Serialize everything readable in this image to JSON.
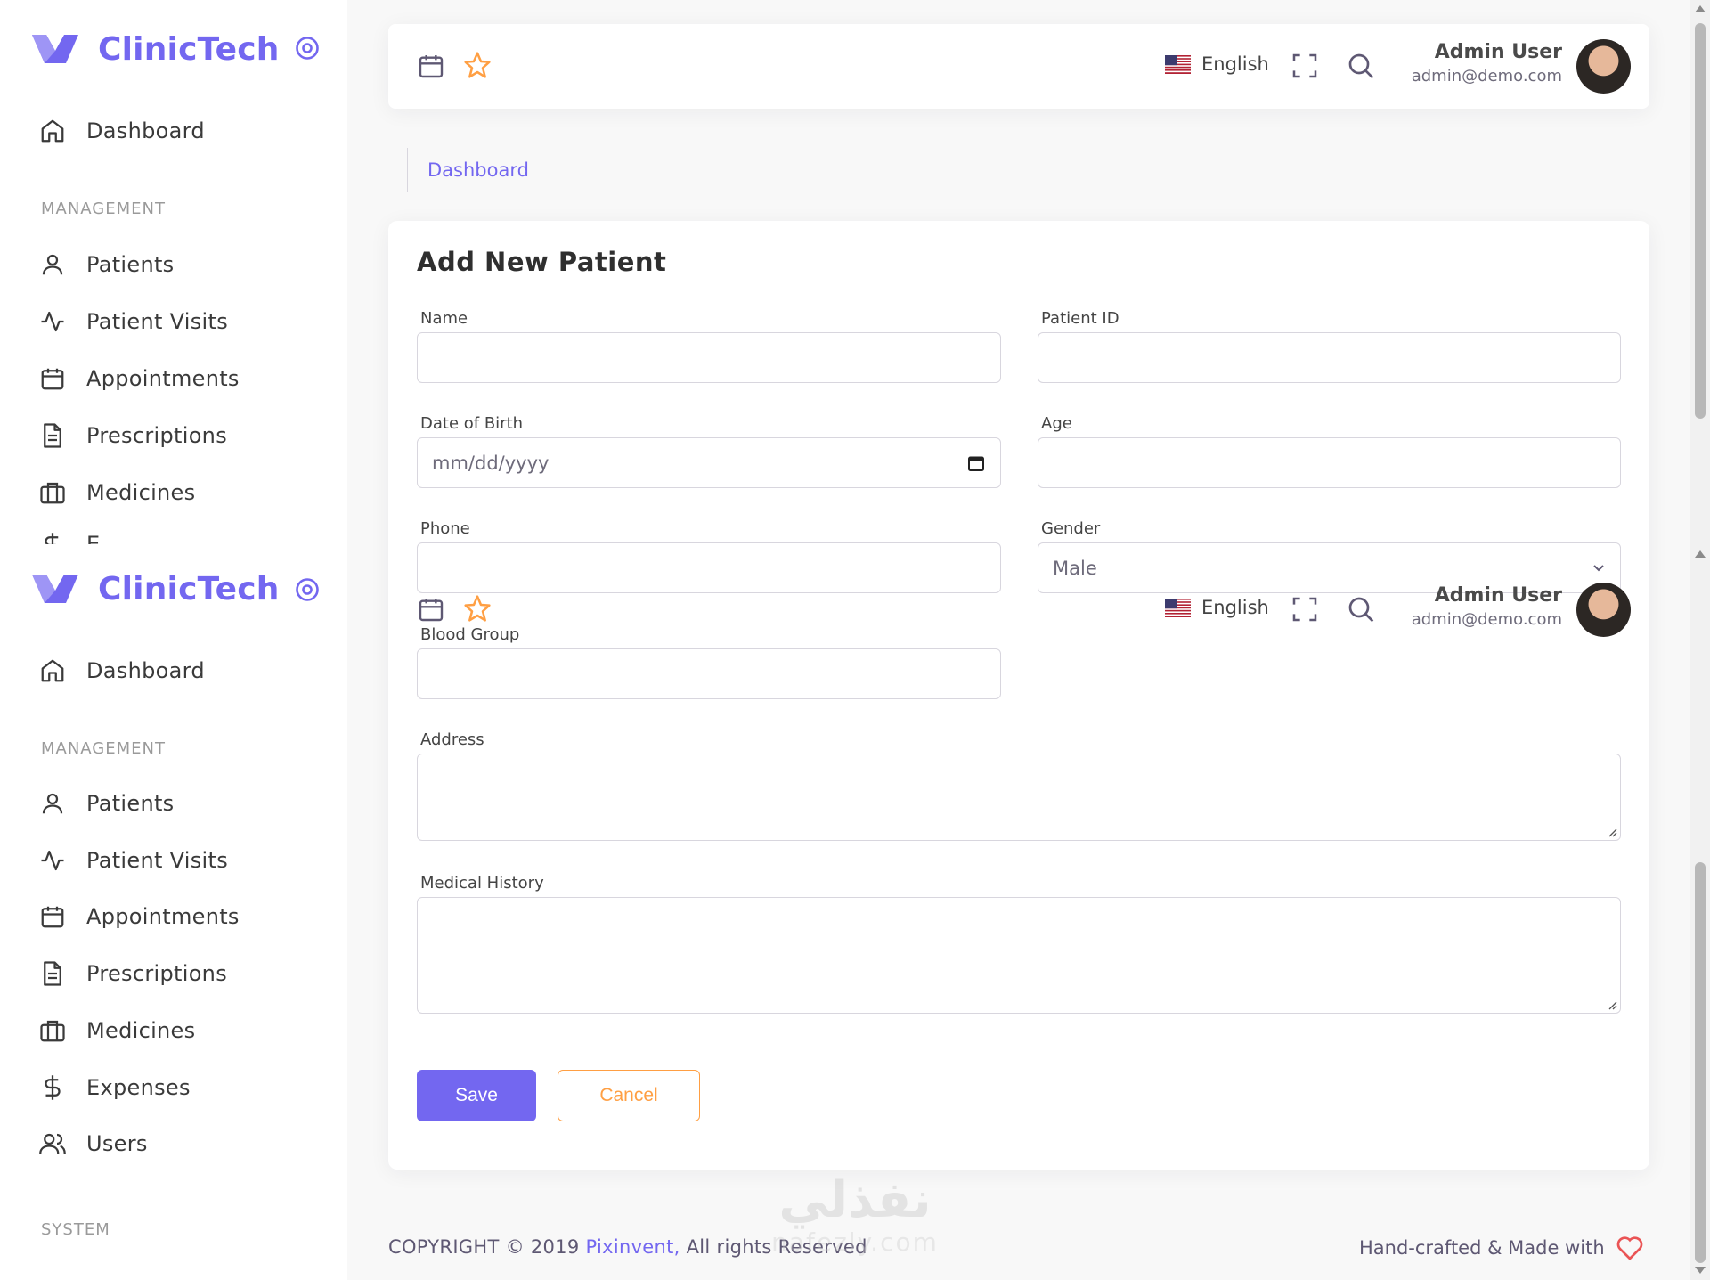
{
  "brand": {
    "name": "ClinicTech",
    "color": "#7367f0"
  },
  "sidebar": {
    "items": [
      {
        "label": "Dashboard",
        "icon": "home-icon"
      },
      {
        "label": "Patients",
        "icon": "user-icon"
      },
      {
        "label": "Patient Visits",
        "icon": "activity-icon"
      },
      {
        "label": "Appointments",
        "icon": "calendar-icon"
      },
      {
        "label": "Prescriptions",
        "icon": "file-text-icon"
      },
      {
        "label": "Medicines",
        "icon": "briefcase-icon"
      },
      {
        "label": "Expenses",
        "icon": "dollar-icon"
      },
      {
        "label": "Users",
        "icon": "users-icon"
      }
    ],
    "sections": {
      "management": "MANAGEMENT",
      "system": "SYSTEM"
    },
    "partial_label": "E"
  },
  "navbar": {
    "language": "English",
    "user_name": "Admin User",
    "user_email": "admin@demo.com"
  },
  "breadcrumb": {
    "current": "Dashboard"
  },
  "form": {
    "title": "Add New Patient",
    "fields": {
      "name": {
        "label": "Name",
        "value": ""
      },
      "patient_id": {
        "label": "Patient ID",
        "value": ""
      },
      "dob": {
        "label": "Date of Birth",
        "placeholder": "mm/dd/yyyy"
      },
      "age": {
        "label": "Age",
        "value": ""
      },
      "phone": {
        "label": "Phone",
        "value": ""
      },
      "gender": {
        "label": "Gender",
        "value": "Male"
      },
      "blood_group": {
        "label": "Blood Group",
        "value": ""
      },
      "address": {
        "label": "Address",
        "value": ""
      },
      "medical_history": {
        "label": "Medical History",
        "value": ""
      }
    },
    "save_label": "Save",
    "cancel_label": "Cancel"
  },
  "footer": {
    "copyright_prefix": "COPYRIGHT © 2019 ",
    "company": "Pixinvent,",
    "rights": " All rights Reserved",
    "tagline": "Hand-crafted & Made with"
  },
  "watermark": {
    "arabic": "نفذلي",
    "latin": "nafezly.com"
  },
  "colors": {
    "accent": "#7367f0",
    "warning": "#ff9f43",
    "heart": "#ea5455"
  }
}
